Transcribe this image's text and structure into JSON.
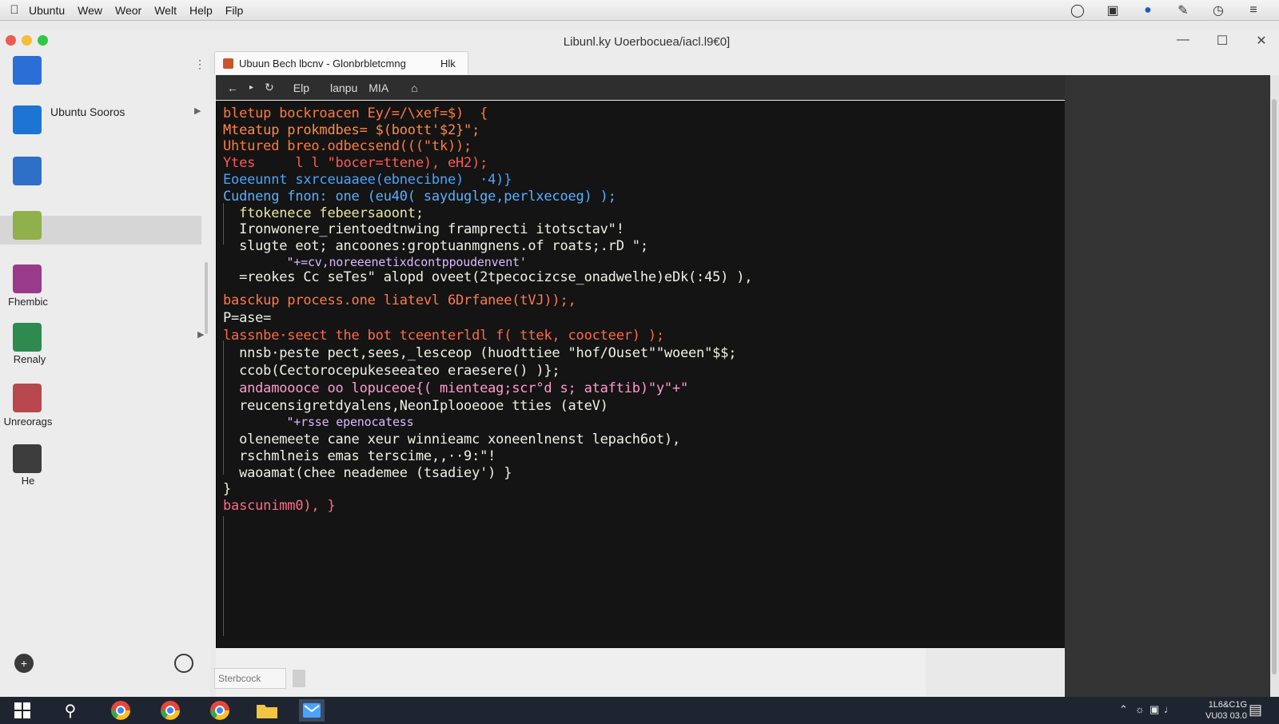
{
  "menubar": {
    "items": [
      "Ubuntu",
      "Wew",
      "Weor",
      "Welt",
      "Help",
      "Filp"
    ]
  },
  "window": {
    "title": "Libunl.ky Uoerbocuea/iacl.l9€0]"
  },
  "sidebar": {
    "items": [
      {
        "label": "Ubuntu Sooros",
        "icon": "list-icon"
      },
      {
        "label": "Fhembic",
        "icon": "music-icon"
      },
      {
        "label": "Renaly",
        "icon": "chat-icon"
      },
      {
        "label": "Unreorags",
        "icon": "paint-icon"
      },
      {
        "label": "He",
        "icon": "user-icon"
      }
    ]
  },
  "tab": {
    "title": "Ubuun Bech lbcnv - Glonbrbletcmng",
    "extra": "Hlk"
  },
  "toolbar": {
    "items": [
      "Elp",
      "lanpu",
      "MIA"
    ]
  },
  "terminal": {
    "lines": [
      {
        "text": "bletup bockroacen Ey/=/\\xef=$)  {",
        "color": "#ff7a3d"
      },
      {
        "text": "Mteatup prokmdbes= $(boott'$2}\";",
        "color": "#ff8a4a"
      },
      {
        "text": "Uhtured breo.odbecsend(((\"tk));",
        "color": "#ff7a3d"
      },
      {
        "text": "Ytes     l l \"bocer=ttene), eH2);",
        "color": "#ff5a52"
      },
      {
        "text": "Eoeeunnt sxrceuaaee(ebnecibne)  ·4)}",
        "color": "#4aa3ff"
      },
      {
        "text": "Cudneng fnon: one (eu40( sayduglge,perlxecoeg) );",
        "color": "#5ab0ff"
      },
      {
        "text": "  ftokenece febeersaoont;",
        "color": "#e8e6a0"
      },
      {
        "text": "  Ironwonere_rientoedtnwing framprecti itotsctav\"!",
        "color": "#f0f0e8"
      },
      {
        "text": "  slugte eot; ancoones:groptuanmgnens.of roats;.rD \";",
        "color": "#f0f0e8"
      },
      {
        "text": "         \"+=cv,noreeenetixdcontppoudenvent'",
        "color": "#d8b8ff"
      },
      {
        "text": "  =reokes Cc seTes\" alopd oveet(2tpecocizcse_onadwelhe)eDk(:45) ),",
        "color": "#f0f0e8"
      },
      {
        "text": "basckup process.one liatevl 6Drfanee(tVJ));,",
        "color": "#ff7a4a"
      },
      {
        "text": "P=ase=",
        "color": "#f0f0e8"
      },
      {
        "text": "lassnbe·seect the bot tceenterldl f( ttek, coocteer) );",
        "color": "#ff6a45"
      },
      {
        "text": "  nnsb·peste pect,sees,_lesceop (huodttiee \"hof/Ouset\"\"woeen\"$$;",
        "color": "#f0f0e8"
      },
      {
        "text": "  ccob(Cectorocepukeseeateo eraesere() )};",
        "color": "#f0f0e8"
      },
      {
        "text": "  andamoooce oo lopuceoe{( mienteag;scr°d s; ataftib)\"y\"+\"",
        "color": "#ff9ad0"
      },
      {
        "text": "  reucensigretdyalens,NeonIplooeooe tties (ateV)",
        "color": "#f0f0e8"
      },
      {
        "text": "         \"+rsse epenocatess",
        "color": "#d8b8ff"
      },
      {
        "text": "  olenemeete cane xeur winnieamc xoneenlnenst lepach6ot),",
        "color": "#f0f0e8"
      },
      {
        "text": "  rschmlneis emas terscime,,··9:\"!",
        "color": "#f0f0e8"
      },
      {
        "text": "  waoamat(chee neademee (tsadiey') }",
        "color": "#f0f0e8"
      },
      {
        "text": "}",
        "color": "#f0f0e8"
      },
      {
        "text": "bascunimm0), }",
        "color": "#ff6a8a"
      }
    ]
  },
  "bottom": {
    "input_placeholder": "Sterbcock"
  },
  "taskbar": {
    "clock_time": "1L6&C1G",
    "clock_date": "VU03 03.0"
  },
  "colors": {
    "terminal_bg": "#141414",
    "taskbar_bg": "#1f2530",
    "accent_blue": "#1f5cc7"
  }
}
